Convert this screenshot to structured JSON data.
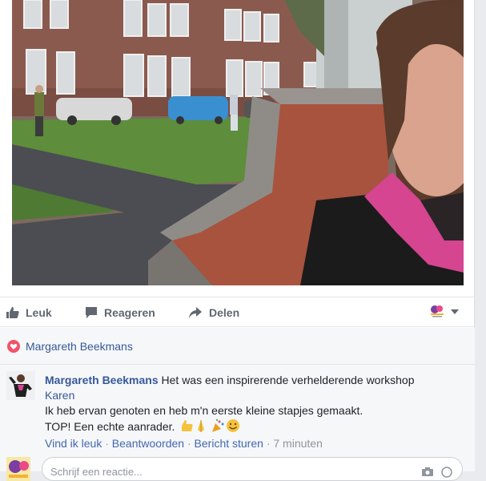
{
  "actions": {
    "like_label": "Leuk",
    "comment_label": "Reageren",
    "share_label": "Delen"
  },
  "reactions": {
    "names": "Margareth Beekmans"
  },
  "comment": {
    "author": "Margareth Beekmans",
    "line1": "Het was een inspirerende verhelderende workshop",
    "tagged": "Karen",
    "line2": "Ik heb ervan genoten en heb m'n eerste kleine stapjes gemaakt.",
    "line3": "TOP! Een echte aanrader.",
    "like_link": "Vind ik leuk",
    "reply_link": "Beantwoorden",
    "message_link": "Bericht sturen",
    "time": "7 minuten",
    "separator": "·"
  },
  "composer": {
    "placeholder": "Schrijf een reactie..."
  },
  "colors": {
    "link": "#365899",
    "meta": "#90949c",
    "action": "#606770",
    "heart": "#f25268"
  }
}
